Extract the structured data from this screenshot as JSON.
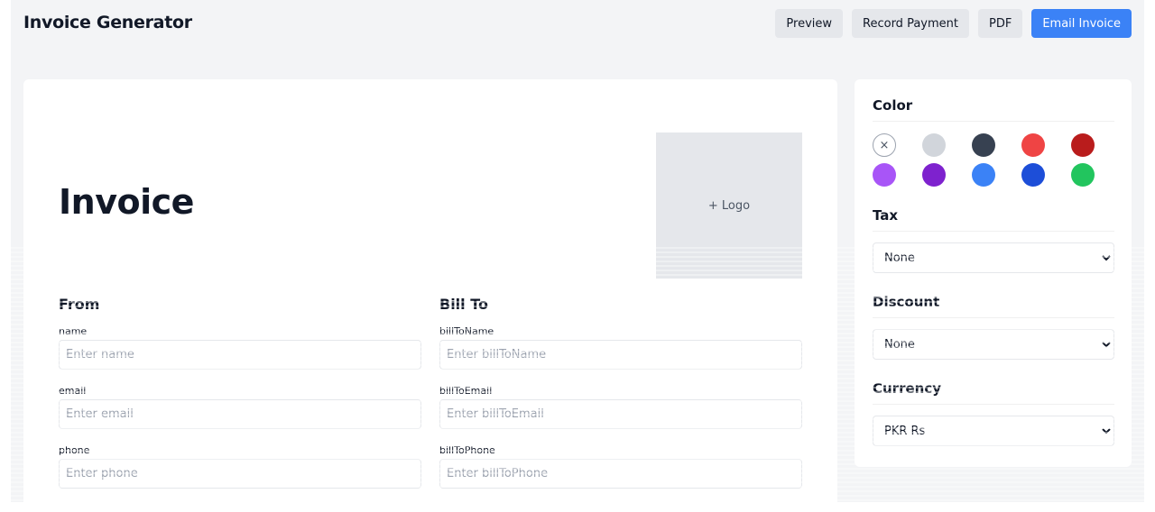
{
  "header": {
    "title": "Invoice Generator",
    "actions": [
      "Preview",
      "Record Payment",
      "PDF",
      "Email Invoice"
    ]
  },
  "invoice": {
    "heading": "Invoice",
    "logo_label": "+ Logo",
    "from": {
      "title": "From",
      "fields": [
        {
          "label": "name",
          "placeholder": "Enter name"
        },
        {
          "label": "email",
          "placeholder": "Enter email"
        },
        {
          "label": "phone",
          "placeholder": "Enter phone"
        }
      ]
    },
    "bill_to": {
      "title": "Bill To",
      "fields": [
        {
          "label": "billToName",
          "placeholder": "Enter billToName"
        },
        {
          "label": "billToEmail",
          "placeholder": "Enter billToEmail"
        },
        {
          "label": "billToPhone",
          "placeholder": "Enter billToPhone"
        }
      ]
    }
  },
  "settings": {
    "color": {
      "title": "Color",
      "none_symbol": "×",
      "swatches": [
        "none",
        "#d1d5db",
        "#374151",
        "#ef4444",
        "#b91c1c",
        "#a855f7",
        "#7e22ce",
        "#3b82f6",
        "#1d4ed8",
        "#22c55e"
      ]
    },
    "tax": {
      "title": "Tax",
      "selected": "None"
    },
    "discount": {
      "title": "Discount",
      "selected": "None"
    },
    "currency": {
      "title": "Currency",
      "selected": "PKR Rs"
    }
  }
}
